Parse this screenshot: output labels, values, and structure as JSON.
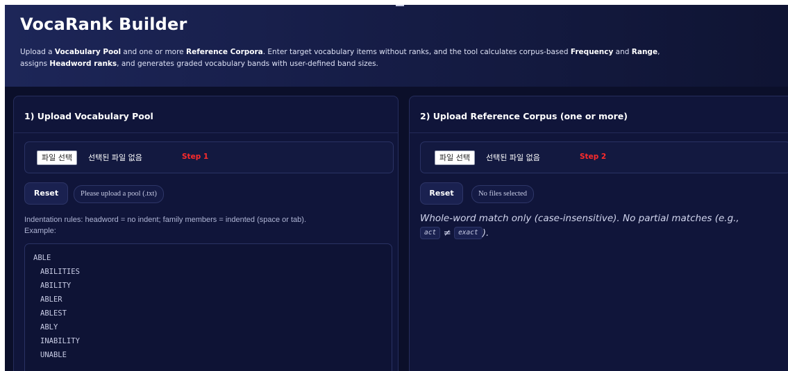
{
  "app": {
    "title": "VocaRank Builder",
    "description": {
      "line1_a": "Upload a ",
      "line1_b": "Vocabulary Pool",
      "line1_c": " and one or more ",
      "line1_d": "Reference Corpora",
      "line1_e": ". Enter target vocabulary items without ranks, and the tool calculates corpus-based ",
      "line1_f": "Frequency",
      "line1_g": " and ",
      "line1_h": "Range",
      "line1_i": ",",
      "line2_a": "assigns ",
      "line2_b": "Headword ranks",
      "line2_c": ", and generates graded vocabulary bands with user-defined band sizes."
    }
  },
  "pool_panel": {
    "title": "1) Upload Vocabulary Pool",
    "file_button": "파일 선택",
    "file_status": "선택된 파일 없음",
    "step_label": "Step 1",
    "reset_label": "Reset",
    "status_pill": "Please upload a pool (.txt)",
    "rules_line1": "Indentation rules: headword = no indent; family members = indented (space or tab).",
    "rules_line2": "Example:",
    "example": {
      "headword": "ABLE",
      "members": [
        "ABILITIES",
        "ABILITY",
        "ABLER",
        "ABLEST",
        "ABLY",
        "INABILITY",
        "UNABLE"
      ]
    }
  },
  "corpus_panel": {
    "title": "2) Upload Reference Corpus (one or more)",
    "file_button": "파일 선택",
    "file_status": "선택된 파일 없음",
    "step_label": "Step 2",
    "reset_label": "Reset",
    "status_pill": "No files selected",
    "match_note": "Whole-word match only (case-insensitive). No partial matches (e.g.,",
    "code_a": "act",
    "neq_symbol": "≠",
    "code_b": "exact",
    "match_note_end": ")."
  }
}
